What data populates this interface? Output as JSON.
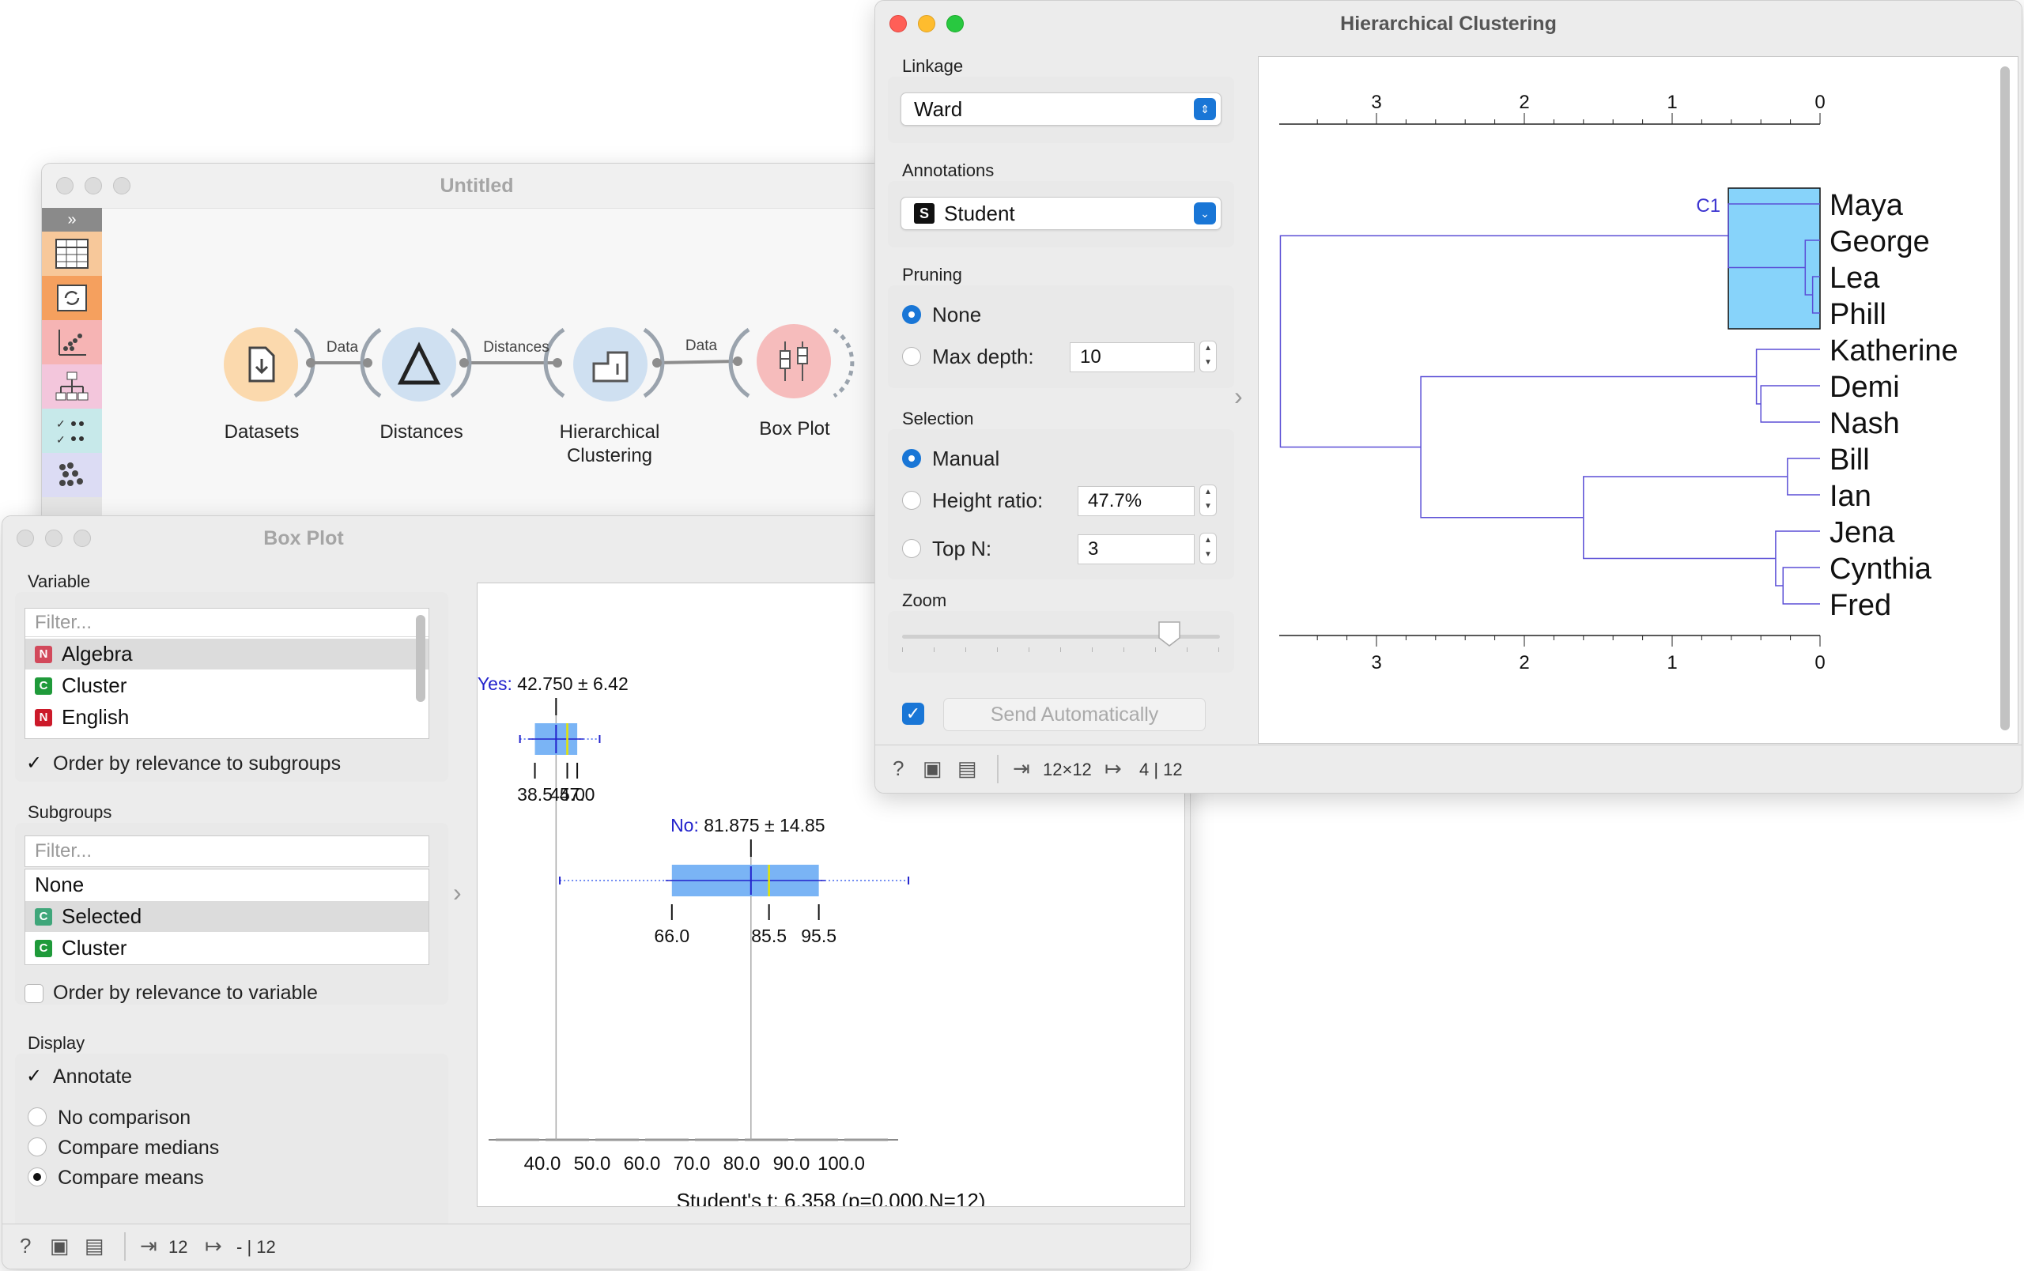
{
  "canvas_window": {
    "title": "Untitled",
    "nodes": [
      {
        "label": "Datasets",
        "icon": "datasets-icon"
      },
      {
        "label": "Distances",
        "icon": "distances-icon"
      },
      {
        "label_line1": "Hierarchical",
        "label_line2": "Clustering",
        "icon": "hierarchical-clustering-icon"
      },
      {
        "label": "Box Plot",
        "icon": "box-plot-icon"
      }
    ],
    "links": [
      "Data",
      "Distances",
      "Data"
    ],
    "toolbox_icons": [
      "expand-icon",
      "table-icon",
      "transform-icon",
      "scatter-icon",
      "tree-icon",
      "evaluate-icon",
      "unsupervised-icon"
    ]
  },
  "hc_window": {
    "title": "Hierarchical Clustering",
    "linkage_label": "Linkage",
    "linkage_value": "Ward",
    "annotations_label": "Annotations",
    "annotations_value": "Student",
    "annotations_badge": "S",
    "pruning_label": "Pruning",
    "pruning_none": "None",
    "pruning_max_depth": "Max depth:",
    "max_depth_value": "10",
    "selection_label": "Selection",
    "sel_manual": "Manual",
    "sel_height_ratio": "Height ratio:",
    "height_ratio_value": "47.7%",
    "sel_top_n": "Top N:",
    "top_n_value": "3",
    "zoom_label": "Zoom",
    "zoom_level": 0.84,
    "send_auto": "Send Automatically",
    "status_in": "12×12",
    "status_out": "4 | 12",
    "cluster_label": "C1",
    "leaves": [
      "Maya",
      "George",
      "Lea",
      "Phill",
      "Katherine",
      "Demi",
      "Nash",
      "Bill",
      "Ian",
      "Jena",
      "Cynthia",
      "Fred"
    ],
    "axis_ticks": [
      "3",
      "2",
      "1",
      "0"
    ],
    "colors": {
      "line": "#5b4fd6",
      "selection": "#87d3fa"
    }
  },
  "bp_window": {
    "title": "Box Plot",
    "variable_label": "Variable",
    "filter_placeholder": "Filter...",
    "variables": [
      {
        "badge": "N",
        "name": "Algebra",
        "color": "#d2495b"
      },
      {
        "badge": "C",
        "name": "Cluster",
        "color": "#1f9a3a"
      },
      {
        "badge": "N",
        "name": "English",
        "color": "#cc1a2a"
      }
    ],
    "order_subgroups": "Order by relevance to subgroups",
    "subgroups_label": "Subgroups",
    "subgroups": [
      {
        "badge": "",
        "name": "None"
      },
      {
        "badge": "C",
        "name": "Selected",
        "color": "#3fa67a"
      },
      {
        "badge": "C",
        "name": "Cluster",
        "color": "#1f9a3a"
      }
    ],
    "order_variable": "Order by relevance to variable",
    "display_label": "Display",
    "annotate": "Annotate",
    "no_comparison": "No comparison",
    "compare_medians": "Compare medians",
    "compare_means": "Compare means",
    "status_in": "12",
    "status_out": "- | 12",
    "stat_text": "Student's t: 6.358 (p=0.000,N=12)",
    "yes_label": "Yes:",
    "yes_stat": "42.750 ± 6.42",
    "yes_q1": "38.5",
    "yes_median": "45.0",
    "yes_q3": "47.0",
    "no_label": "No:",
    "no_stat": "81.875 ± 14.85",
    "no_q1": "66.0",
    "no_median": "85.5",
    "no_q3": "95.5",
    "axis_ticks": [
      "40.0",
      "50.0",
      "60.0",
      "70.0",
      "80.0",
      "90.0",
      "100.0"
    ],
    "colors": {
      "box": "#7ab4f5",
      "mean": "#2222cc",
      "median": "#e5e500"
    }
  }
}
